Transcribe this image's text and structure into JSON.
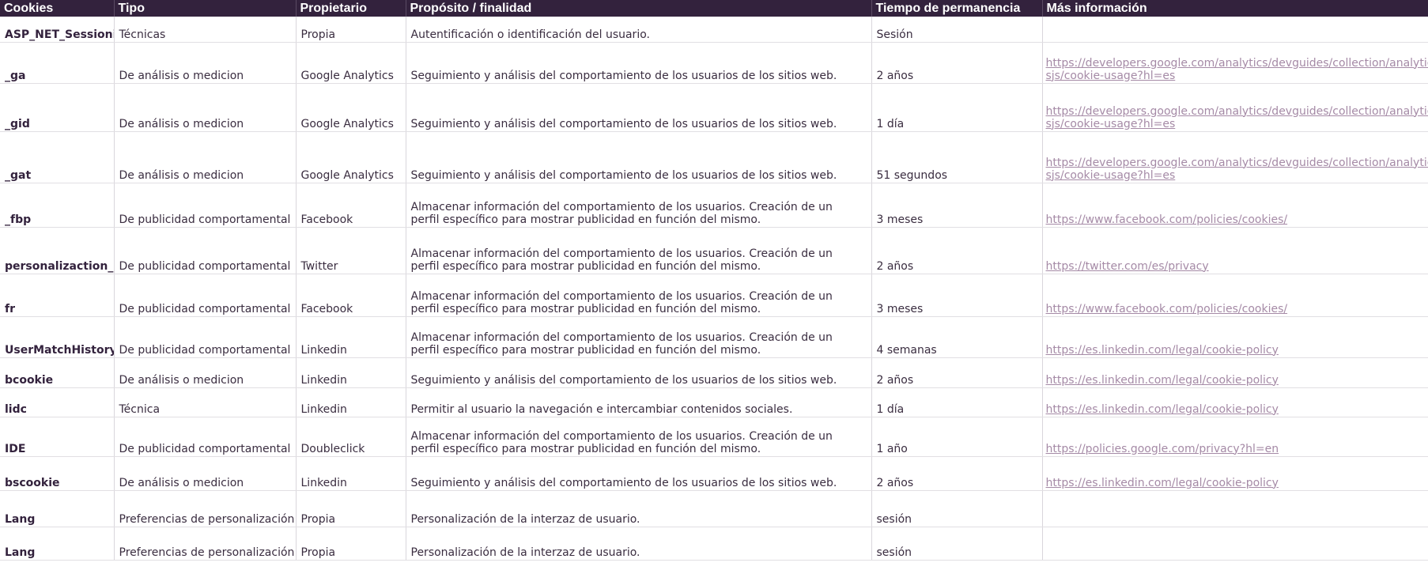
{
  "headers": {
    "cookies": "Cookies",
    "tipo": "Tipo",
    "propietario": "Propietario",
    "proposito": "Propósito / finalidad",
    "tiempo": "Tiempo de permanencia",
    "info": "Más información"
  },
  "rows": [
    {
      "name": "ASP_NET_Sessionid",
      "tipo": "Técnicas",
      "propietario": "Propia",
      "proposito": "Autentificación o identificación del usuario.",
      "tiempo": "Sesión",
      "info": ""
    },
    {
      "name": "_ga",
      "tipo": "De análisis o medicion",
      "propietario": "Google Analytics",
      "proposito": "Seguimiento y análisis del comportamiento de los usuarios de los sitios web.",
      "tiempo": "2 años",
      "info": "https://developers.google.com/analytics/devguides/collection/analyticsjs/cookie-usage?hl=es"
    },
    {
      "name": "_gid",
      "tipo": "De análisis o medicion",
      "propietario": "Google Analytics",
      "proposito": "Seguimiento y análisis del comportamiento de los usuarios de los sitios web.",
      "tiempo": "1 día",
      "info": "https://developers.google.com/analytics/devguides/collection/analyticsjs/cookie-usage?hl=es"
    },
    {
      "name": "_gat",
      "tipo": "De análisis o medicion",
      "propietario": "Google Analytics",
      "proposito": "Seguimiento y análisis del comportamiento de los usuarios de los sitios web.",
      "tiempo": "51 segundos",
      "info": "https://developers.google.com/analytics/devguides/collection/analyticsjs/cookie-usage?hl=es"
    },
    {
      "name": "_fbp",
      "tipo": "De publicidad comportamental",
      "propietario": "Facebook",
      "proposito": "Almacenar información del comportamiento de los usuarios. Creación de un perfil específico para mostrar publicidad en función del mismo.",
      "tiempo": "3 meses",
      "info": "https://www.facebook.com/policies/cookies/"
    },
    {
      "name": "personalizaction_id",
      "tipo": "De publicidad comportamental",
      "propietario": "Twitter",
      "proposito": "Almacenar información del comportamiento de los usuarios. Creación de un perfil específico para mostrar publicidad en función del mismo.",
      "tiempo": "2 años",
      "info": "https://twitter.com/es/privacy"
    },
    {
      "name": "fr",
      "tipo": "De publicidad comportamental",
      "propietario": "Facebook",
      "proposito": "Almacenar información del comportamiento de los usuarios. Creación de un perfil específico para mostrar publicidad en función del mismo.",
      "tiempo": "3 meses",
      "info": "https://www.facebook.com/policies/cookies/"
    },
    {
      "name": "UserMatchHistory",
      "tipo": "De publicidad comportamental",
      "propietario": "Linkedin",
      "proposito": "Almacenar información del comportamiento de los usuarios. Creación de un perfil específico para mostrar publicidad en función del mismo.",
      "tiempo": "4 semanas",
      "info": "https://es.linkedin.com/legal/cookie-policy"
    },
    {
      "name": "bcookie",
      "tipo": "De análisis o medicion",
      "propietario": "Linkedin",
      "proposito": "Seguimiento y análisis del comportamiento de los usuarios de los sitios web.",
      "tiempo": "2 años",
      "info": "https://es.linkedin.com/legal/cookie-policy"
    },
    {
      "name": "lidc",
      "tipo": "Técnica",
      "propietario": "Linkedin",
      "proposito": "Permitir al usuario la navegación e intercambiar contenidos sociales.",
      "tiempo": "1 día",
      "info": "https://es.linkedin.com/legal/cookie-policy"
    },
    {
      "name": "IDE",
      "tipo": "De publicidad comportamental",
      "propietario": "Doubleclick",
      "proposito": "Almacenar información del comportamiento de los usuarios. Creación de un perfil específico para mostrar publicidad en función del mismo.",
      "tiempo": "1 año",
      "info": "https://policies.google.com/privacy?hl=en"
    },
    {
      "name": "bscookie",
      "tipo": "De análisis o medicion",
      "propietario": "Linkedin",
      "proposito": "Seguimiento y análisis del comportamiento de los usuarios de los sitios web.",
      "tiempo": "2 años",
      "info": "https://es.linkedin.com/legal/cookie-policy"
    },
    {
      "name": "Lang",
      "tipo": "Preferencias de personalización",
      "propietario": "Propia",
      "proposito": "Personalización de la interzaz de usuario.",
      "tiempo": "sesión",
      "info": ""
    },
    {
      "name": "Lang",
      "tipo": "Preferencias de personalización",
      "propietario": "Propia",
      "proposito": "Personalización de la interzaz de usuario.",
      "tiempo": "sesión",
      "info": ""
    }
  ],
  "colors": {
    "header_bg": "#33223d",
    "header_text": "#ffffff",
    "link": "#a58aa6",
    "grid": "#e1dfe3"
  }
}
